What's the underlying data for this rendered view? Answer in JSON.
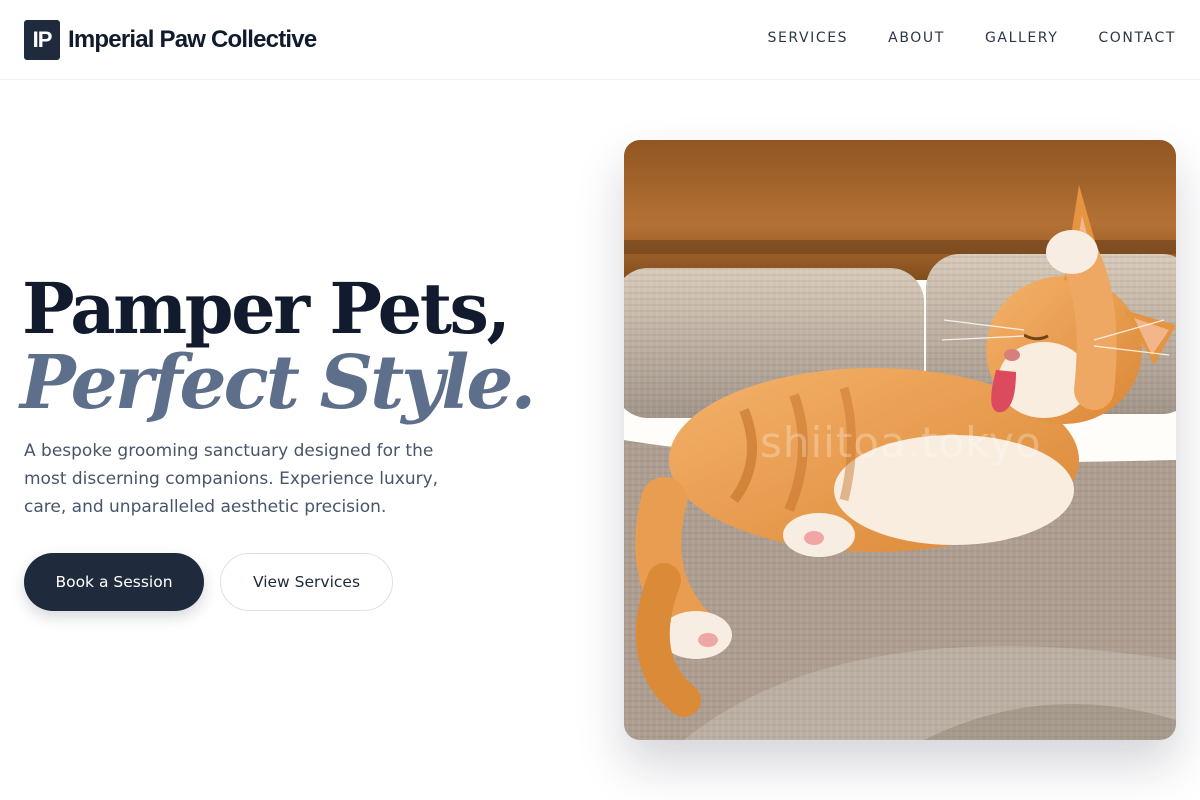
{
  "header": {
    "logo_initials": "IP",
    "brand_name": "Imperial Paw Collective",
    "nav": [
      {
        "label": "SERVICES"
      },
      {
        "label": "ABOUT"
      },
      {
        "label": "GALLERY"
      },
      {
        "label": "CONTACT"
      }
    ]
  },
  "hero": {
    "headline_line1": "Pamper Pets,",
    "headline_line2": "Perfect Style.",
    "description": "A bespoke grooming sanctuary designed for the most discerning companions. Experience luxury, care, and unparalleled aesthetic precision.",
    "primary_button": "Book a Session",
    "secondary_button": "View Services",
    "image": {
      "subject": "orange-and-white cat grooming its paw on a sofa",
      "watermark": "shiitoa.tokyo"
    }
  },
  "colors": {
    "primary": "#1f2a3c",
    "heading": "#111b2d",
    "accent_italic": "#5d6f8a",
    "body_text": "#475569"
  }
}
